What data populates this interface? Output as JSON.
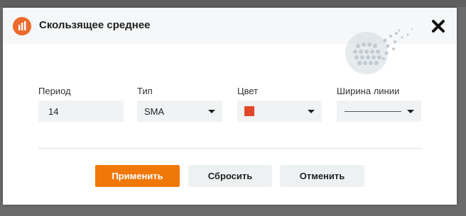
{
  "dialog": {
    "title": "Скользящее среднее",
    "header_icon": "chart-bars-icon",
    "close_icon": "close-icon"
  },
  "fields": {
    "period": {
      "label": "Период",
      "value": "14"
    },
    "type": {
      "label": "Тип",
      "value": "SMA"
    },
    "color": {
      "label": "Цвет",
      "value": "#e1462a"
    },
    "line_width": {
      "label": "Ширина линии"
    }
  },
  "buttons": {
    "apply": "Применить",
    "reset": "Сбросить",
    "cancel": "Отменить"
  },
  "colors": {
    "accent": "#f07808",
    "header_icon": "#ec6a2c",
    "swatch": "#e1462a"
  }
}
